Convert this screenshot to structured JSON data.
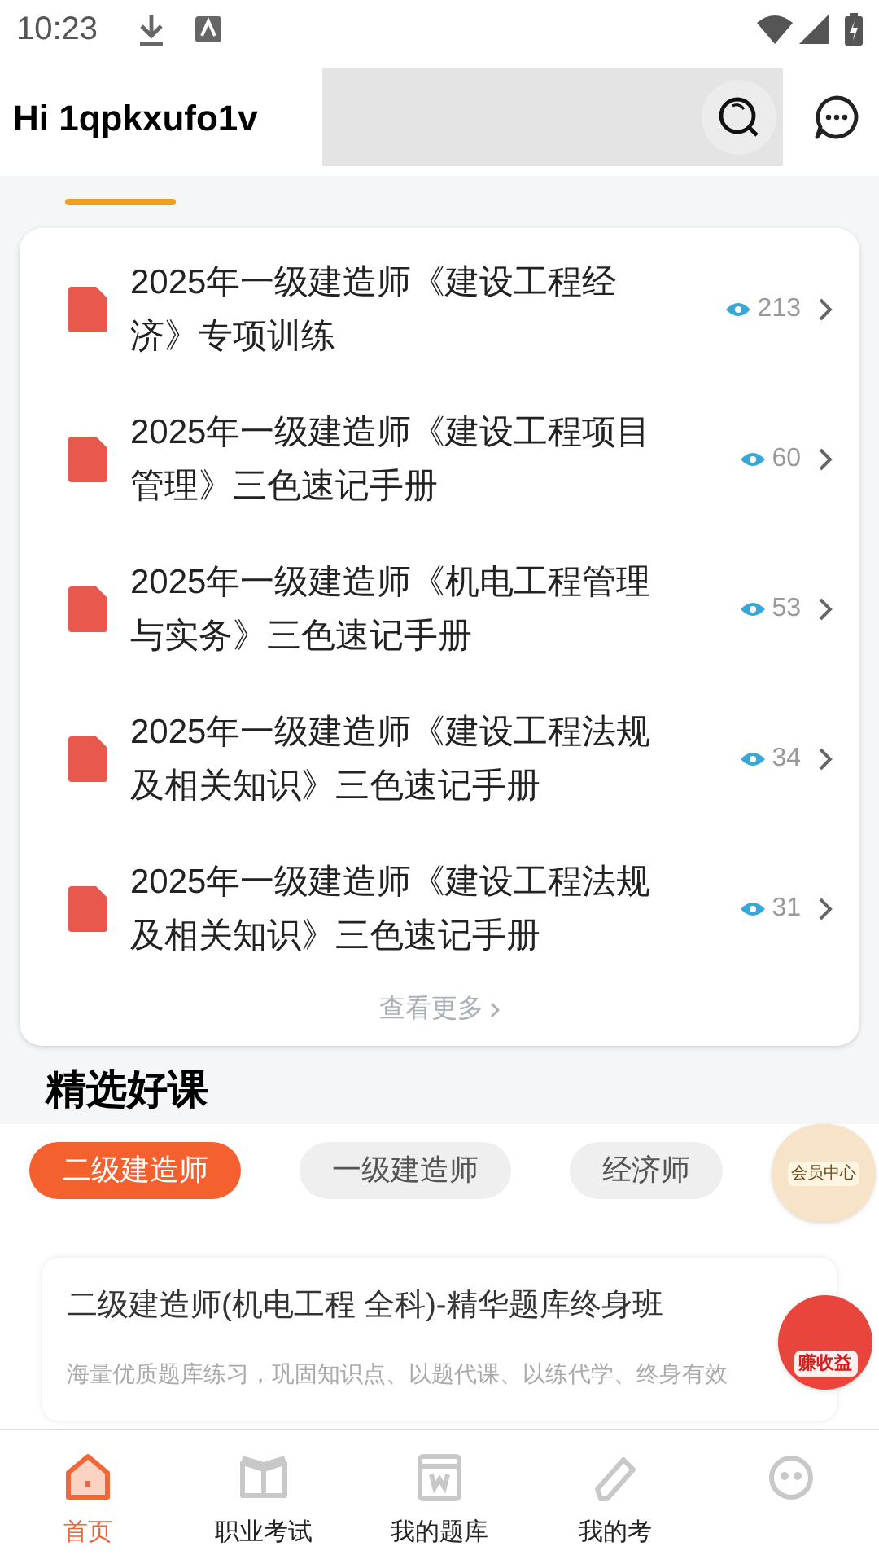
{
  "status_bar": {
    "time": "10:23"
  },
  "header": {
    "greeting": "Hi 1qpkxufo1v"
  },
  "documents": [
    {
      "title": "2025年一级建造师《建设工程经济》专项训练",
      "views": "213"
    },
    {
      "title": "2025年一级建造师《建设工程项目管理》三色速记手册",
      "views": "60"
    },
    {
      "title": "2025年一级建造师《机电工程管理与实务》三色速记手册",
      "views": "53"
    },
    {
      "title": "2025年一级建造师《建设工程法规及相关知识》三色速记手册",
      "views": "34"
    },
    {
      "title": "2025年一级建造师《建设工程法规及相关知识》三色速记手册",
      "views": "31"
    }
  ],
  "more_link": "查看更多",
  "section_title": "精选好课",
  "chips": [
    {
      "label": "二级建造师",
      "selected": true
    },
    {
      "label": "一级建造师",
      "selected": false
    },
    {
      "label": "经济师",
      "selected": false
    }
  ],
  "float_badges": [
    "会员中心",
    "赚收益"
  ],
  "course": {
    "title": "二级建造师(机电工程 全科)-精华题库终身班",
    "description": "海量优质题库练习，巩固知识点、以题代课、以练代学、终身有效"
  },
  "tab_bar": [
    {
      "label": "首页",
      "selected": true,
      "kind": "home"
    },
    {
      "label": "职业考试",
      "selected": false,
      "kind": "book"
    },
    {
      "label": "我的题库",
      "selected": false,
      "kind": "bank"
    },
    {
      "label": "我的考",
      "selected": false,
      "kind": "pencil"
    },
    {
      "selected": false,
      "kind": "face"
    }
  ]
}
